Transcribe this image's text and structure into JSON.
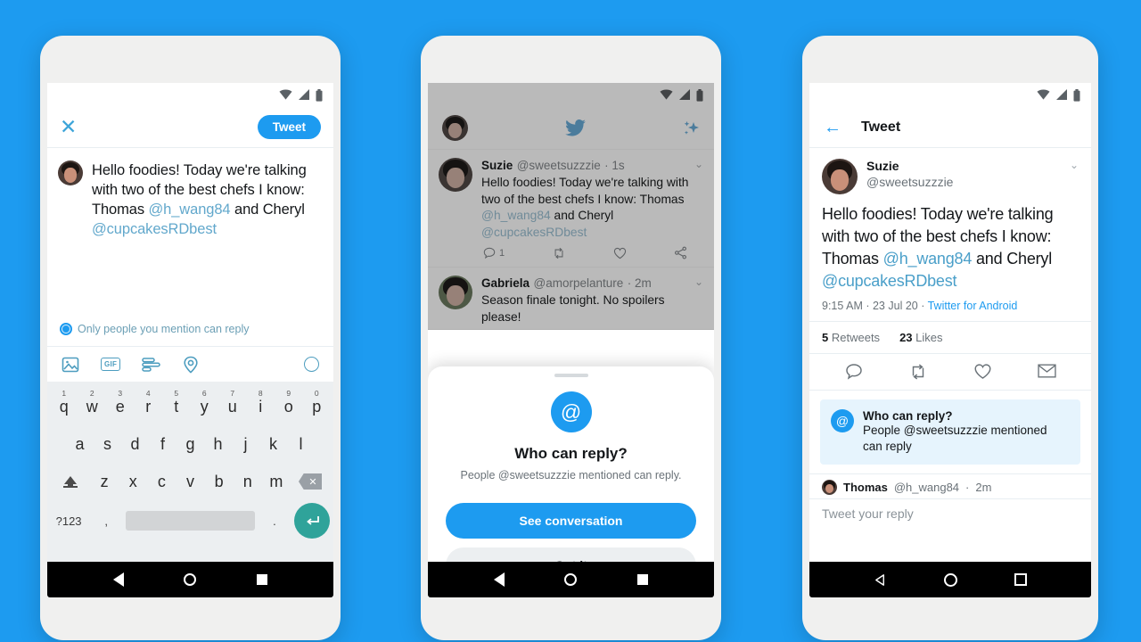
{
  "background_color": "#1d9bf0",
  "accent_color": "#1d9bf0",
  "phone1": {
    "name": "compose-tweet-screen",
    "header": {
      "close_label": "✕",
      "tweet_button": "Tweet"
    },
    "composer": {
      "text_part1": "Hello foodies! Today we're talking with two of the best chefs I know: Thomas ",
      "mention1": "@h_wang84",
      "text_part2": " and Cheryl ",
      "mention2": "@cupcakesRDbest",
      "reply_scope": "Only people you mention can reply"
    },
    "toolbar": {
      "media_icon": "image-icon",
      "gif_label": "GIF",
      "poll_icon": "poll-icon",
      "location_icon": "location-pin-icon",
      "progress_icon": "character-count-ring"
    },
    "keyboard": {
      "row1": [
        {
          "key": "q",
          "num": "1"
        },
        {
          "key": "w",
          "num": "2"
        },
        {
          "key": "e",
          "num": "3"
        },
        {
          "key": "r",
          "num": "4"
        },
        {
          "key": "t",
          "num": "5"
        },
        {
          "key": "y",
          "num": "6"
        },
        {
          "key": "u",
          "num": "7"
        },
        {
          "key": "i",
          "num": "8"
        },
        {
          "key": "o",
          "num": "9"
        },
        {
          "key": "p",
          "num": "0"
        }
      ],
      "row2": [
        "a",
        "s",
        "d",
        "f",
        "g",
        "h",
        "j",
        "k",
        "l"
      ],
      "row3": [
        "z",
        "x",
        "c",
        "v",
        "b",
        "n",
        "m"
      ],
      "symbols_key": "?123",
      "comma_key": ",",
      "period_key": ".",
      "shift_icon": "shift-caps-icon",
      "delete_icon": "backspace-icon",
      "enter_icon": "enter-return-icon",
      "space_key": "space"
    }
  },
  "phone2": {
    "name": "timeline-with-who-can-reply-sheet",
    "topbar": {
      "avatar": "user-avatar",
      "logo": "twitter-bird-icon",
      "sparkle": "sparkle-icon"
    },
    "tweets": [
      {
        "name": "Suzie",
        "handle": "@sweetsuzzzie",
        "time": "1s",
        "text_part1": "Hello foodies! Today we're talking with two of the best chefs I know: Thomas ",
        "mention1": "@h_wang84",
        "text_part2": " and Cheryl ",
        "mention2": "@cupcakesRDbest",
        "reply_count": "1"
      },
      {
        "name": "Gabriela",
        "handle": "@amorpelanture",
        "time": "2m",
        "text": "Season finale tonight. No spoilers please!"
      }
    ],
    "sheet": {
      "icon": "at-mention-icon",
      "title": "Who can reply?",
      "subtitle": "People @sweetsuzzzie mentioned can reply.",
      "primary_button": "See conversation",
      "secondary_button": "Got it"
    }
  },
  "phone3": {
    "name": "tweet-detail-screen",
    "header": {
      "back": "←",
      "title": "Tweet"
    },
    "tweet": {
      "name": "Suzie",
      "handle": "@sweetsuzzzie",
      "text_part1": "Hello foodies! Today we're talking with two of the best chefs I know: Thomas ",
      "mention1": "@h_wang84",
      "text_part2": " and Cheryl ",
      "mention2": "@cupcakesRDbest",
      "time": "9:15 AM",
      "date": "23 Jul 20",
      "client": "Twitter for Android",
      "separator": " · ",
      "retweets_count": "5",
      "retweets_label": "Retweets",
      "likes_count": "23",
      "likes_label": "Likes"
    },
    "actions": {
      "reply_icon": "reply-bubble-icon",
      "retweet_icon": "retweet-icon",
      "like_icon": "heart-icon",
      "share_icon": "share-envelope-icon"
    },
    "info_box": {
      "icon": "at-mention-icon",
      "title": "Who can reply?",
      "subtitle": "People @sweetsuzzzie mentioned can reply"
    },
    "reply": {
      "name": "Thomas",
      "handle": "@h_wang84",
      "time": "2m",
      "placeholder": "Tweet your reply"
    }
  },
  "navbar": {
    "back": "back-triangle-icon",
    "home": "home-circle-icon",
    "recents": "recents-square-icon"
  }
}
